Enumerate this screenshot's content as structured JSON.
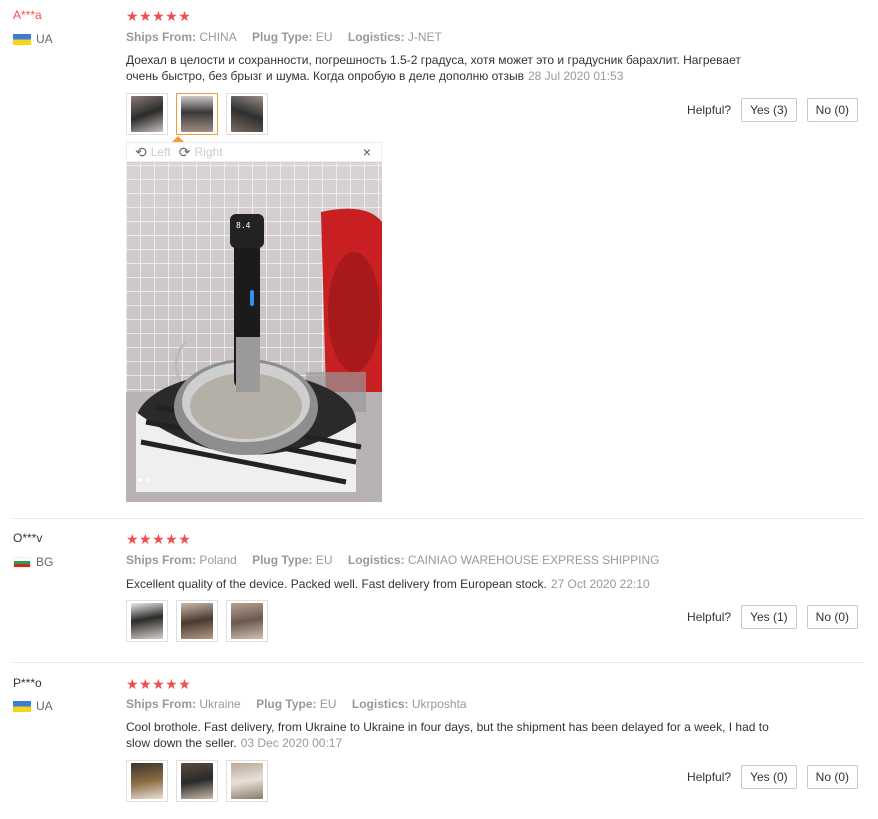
{
  "reviews": [
    {
      "user": "A***a",
      "country": "UA",
      "stars": "★★★★★",
      "ships_from_label": "Ships From:",
      "ships_from": "CHINA",
      "plug_label": "Plug Type:",
      "plug": "EU",
      "logistics_label": "Logistics:",
      "logistics": "J-NET",
      "text": "Доехал в целости и сохранности, погрешность 1.5-2 градуса, хотя может это и градусник барахлит. Нагревает очень быстро, без брызг и шума. Когда опробую в деле дополню отзыв",
      "date": "28 Jul 2020 01:53",
      "helpful": "Helpful?",
      "yes": "Yes (3)",
      "no": "No (0)"
    },
    {
      "user": "O***v",
      "country": "BG",
      "stars": "★★★★★",
      "ships_from_label": "Ships From:",
      "ships_from": "Poland",
      "plug_label": "Plug Type:",
      "plug": "EU",
      "logistics_label": "Logistics:",
      "logistics": "CAINIAO WAREHOUSE EXPRESS SHIPPING",
      "text": "Excellent quality of the device. Packed well. Fast delivery from European stock.",
      "date": "27 Oct 2020 22:10",
      "helpful": "Helpful?",
      "yes": "Yes (1)",
      "no": "No (0)"
    },
    {
      "user": "P***o",
      "country": "UA",
      "stars": "★★★★★",
      "ships_from_label": "Ships From:",
      "ships_from": "Ukraine",
      "plug_label": "Plug Type:",
      "plug": "EU",
      "logistics_label": "Logistics:",
      "logistics": "Ukrposhta",
      "text": "Cool brothole. Fast delivery, from Ukraine to Ukraine in four days, but the shipment has been delayed for a week, I had to slow down the seller.",
      "date": "03 Dec 2020 00:17",
      "helpful": "Helpful?",
      "yes": "Yes (0)",
      "no": "No (0)"
    }
  ],
  "viewer": {
    "left_label": "Left",
    "right_label": "Right",
    "close": "×",
    "rotate_left_icon": "⟲",
    "rotate_right_icon": "⟳"
  }
}
